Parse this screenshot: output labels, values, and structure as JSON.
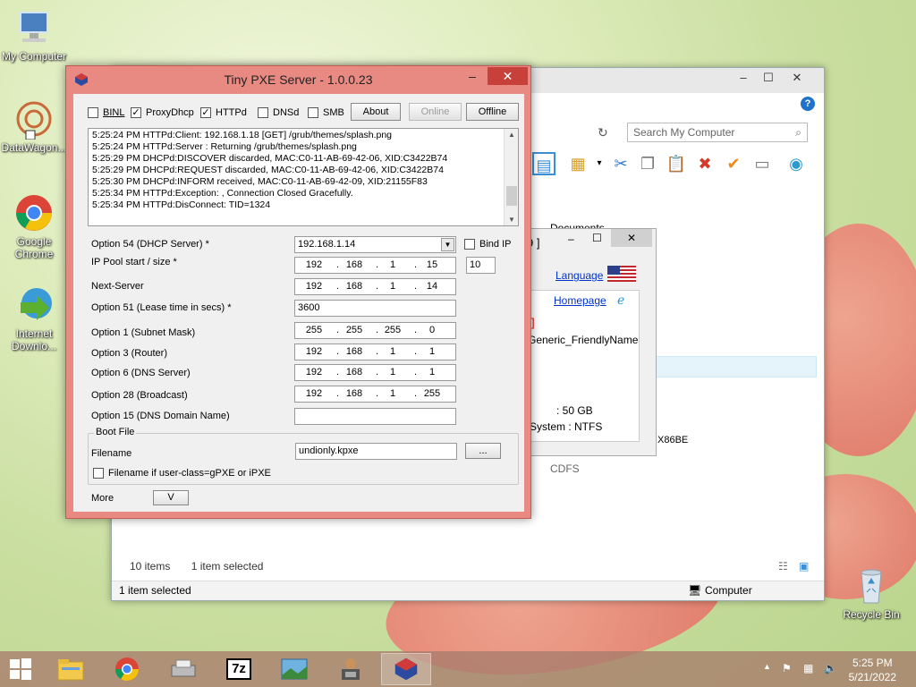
{
  "desktop": {
    "icons": [
      {
        "label": "My Computer"
      },
      {
        "label": "DataWagon..."
      },
      {
        "label": "Google Chrome"
      },
      {
        "label": "Internet Downlo..."
      },
      {
        "label": "Recycle Bin"
      }
    ]
  },
  "explorer": {
    "search_placeholder": "Search My Computer",
    "items_count": "10 items",
    "selection": "1 item selected",
    "status_left": "1 item selected",
    "status_right": "Computer",
    "partial_labels": {
      "documents": "Documents",
      "x86be": "X86BE",
      "cdfs": "CDFS"
    }
  },
  "midwin": {
    "title_fragment": "9 ]",
    "language": "Language",
    "homepage": "Homepage",
    "bracket": "]",
    "friendly_name": "Generic_FriendlyName",
    "size": ": 50 GB",
    "filesystem": "System  : NTFS"
  },
  "pxe": {
    "title": "Tiny PXE Server - 1.0.0.23",
    "toggles": [
      {
        "label": "BINL",
        "checked": false
      },
      {
        "label": "ProxyDhcp",
        "checked": true
      },
      {
        "label": "HTTPd",
        "checked": true
      },
      {
        "label": "DNSd",
        "checked": false
      },
      {
        "label": "SMB",
        "checked": false
      }
    ],
    "buttons": {
      "about": "About",
      "online": "Online",
      "offline": "Offline"
    },
    "log": [
      "5:25:24 PM HTTPd:Client: 192.168.1.18 [GET] /grub/themes/splash.png",
      "5:25:24 PM HTTPd:Server : Returning /grub/themes/splash.png",
      "5:25:29 PM DHCPd:DISCOVER discarded, MAC:C0-11-AB-69-42-06, XID:C3422B74",
      "5:25:29 PM DHCPd:REQUEST discarded, MAC:C0-11-AB-69-42-06, XID:C3422B74",
      "5:25:30 PM DHCPd:INFORM received, MAC:C0-11-AB-69-42-09, XID:21155F83",
      "5:25:34 PM HTTPd:Exception: , Connection Closed Gracefully.",
      "5:25:34 PM HTTPd:DisConnect: TID=1324"
    ],
    "fields": {
      "opt54_label": "Option 54 (DHCP Server) *",
      "opt54_value": "192.168.1.14",
      "bind_ip": "Bind IP",
      "pool_label": "IP Pool start / size *",
      "pool_ip": [
        "192",
        "168",
        "1",
        "15"
      ],
      "pool_size": "10",
      "next_label": "Next-Server",
      "next_ip": [
        "192",
        "168",
        "1",
        "14"
      ],
      "opt51_label": "Option 51 (Lease time in secs) *",
      "opt51_value": "3600",
      "opt1_label": "Option 1  (Subnet Mask)",
      "opt1_ip": [
        "255",
        "255",
        "255",
        "0"
      ],
      "opt3_label": "Option 3  (Router)",
      "opt3_ip": [
        "192",
        "168",
        "1",
        "1"
      ],
      "opt6_label": "Option 6  (DNS Server)",
      "opt6_ip": [
        "192",
        "168",
        "1",
        "1"
      ],
      "opt28_label": "Option 28 (Broadcast)",
      "opt28_ip": [
        "192",
        "168",
        "1",
        "255"
      ],
      "opt15_label": "Option 15 (DNS Domain Name)",
      "opt15_value": ""
    },
    "boot": {
      "legend": "Boot File",
      "filename_label": "Filename",
      "filename_value": "undionly.kpxe",
      "browse": "...",
      "userclass_label": "Filename if user-class=gPXE or iPXE"
    },
    "more_label": "More",
    "more_button": "V"
  },
  "taskbar": {
    "time": "5:25 PM",
    "date": "5/21/2022"
  }
}
